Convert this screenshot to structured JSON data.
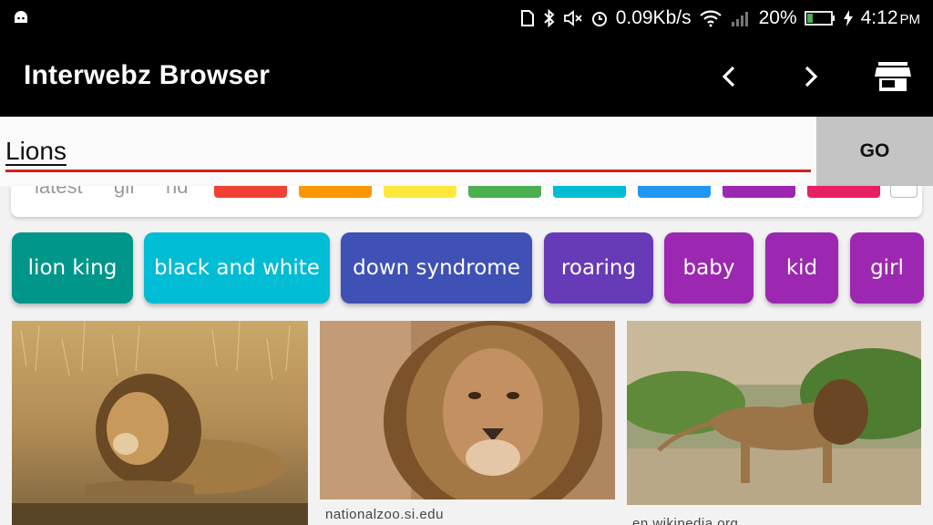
{
  "status_bar": {
    "net_speed": "0.09Kb/s",
    "battery": "20%",
    "time": "4:12",
    "ampm": "PM",
    "icons": [
      "android-icon",
      "nfc-icon",
      "bluetooth-icon",
      "mute-icon",
      "alarm-icon",
      "wifi-icon",
      "signal-icon",
      "battery-icon",
      "charging-icon"
    ]
  },
  "app_bar": {
    "title": "Interwebz Browser",
    "icons": [
      "chevron-left-icon",
      "chevron-right-icon",
      "store-icon"
    ]
  },
  "search": {
    "value": "Lions",
    "go_label": "GO",
    "underline_color": "#d32020"
  },
  "filters": {
    "labels": [
      "latest",
      "gif",
      "hd"
    ],
    "swatches": [
      "#ef4136",
      "#ff9800",
      "#fde93b",
      "#4caf50",
      "#00bcd4",
      "#2196f3",
      "#9c27b0",
      "#e91e63",
      "#ffffff"
    ]
  },
  "tags": [
    {
      "label": "lion king",
      "color": "#00968a"
    },
    {
      "label": "black and white",
      "color": "#00bcd4"
    },
    {
      "label": "down syndrome",
      "color": "#3f51b5"
    },
    {
      "label": "roaring",
      "color": "#673ab7"
    },
    {
      "label": "baby",
      "color": "#9c27b0"
    },
    {
      "label": "kid",
      "color": "#9c27b0"
    },
    {
      "label": "girl",
      "color": "#9c27b0"
    }
  ],
  "results": [
    {
      "source": ""
    },
    {
      "source": "nationalzoo.si.edu"
    },
    {
      "source": "en.wikipedia.org"
    }
  ]
}
